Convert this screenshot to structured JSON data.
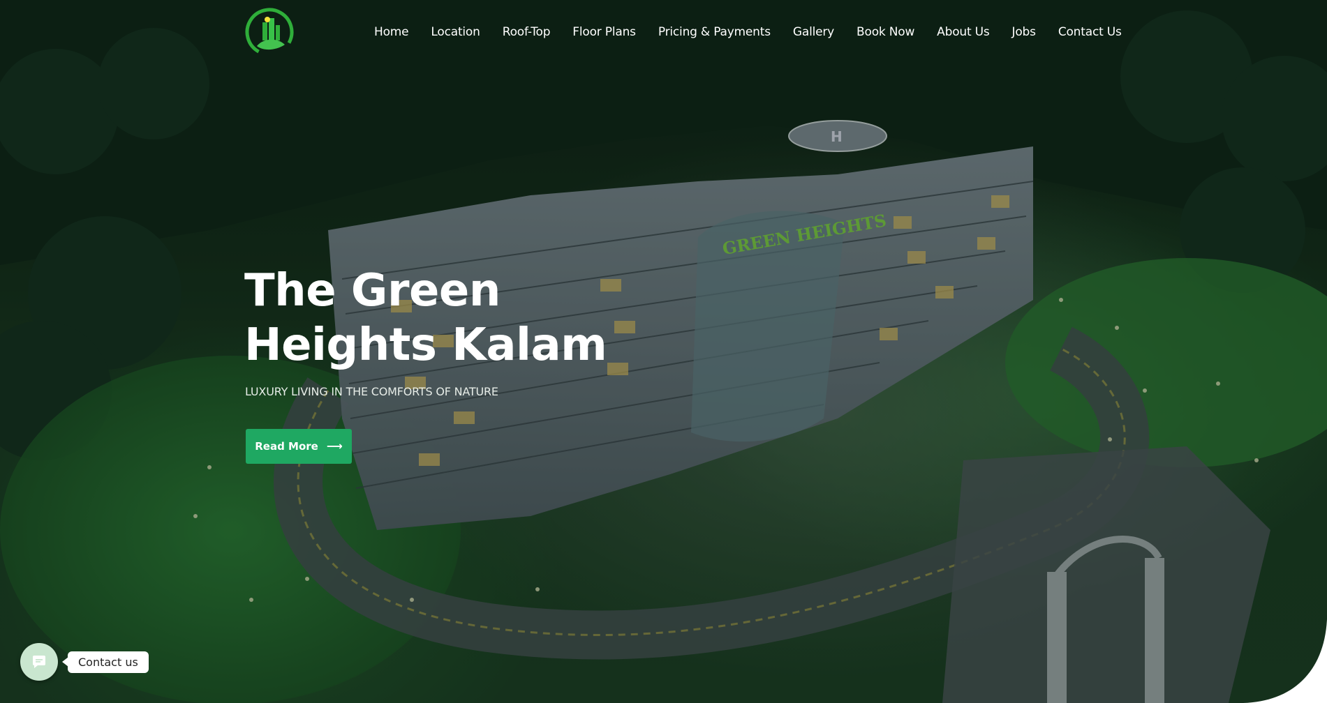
{
  "brand": {
    "logo_icon": "green-heights-logo-icon",
    "accent_color": "#1fa862"
  },
  "nav": {
    "items": [
      {
        "label": "Home"
      },
      {
        "label": "Location"
      },
      {
        "label": "Roof-Top"
      },
      {
        "label": "Floor Plans"
      },
      {
        "label": "Pricing & Payments"
      },
      {
        "label": "Gallery"
      },
      {
        "label": "Book Now"
      },
      {
        "label": "About Us"
      },
      {
        "label": "Jobs"
      },
      {
        "label": "Contact Us"
      }
    ]
  },
  "hero": {
    "title_line1": "The Green",
    "title_line2": "Heights Kalam",
    "subtitle": "LUXURY LIVING IN THE COMFORTS OF NATURE",
    "cta_label": "Read More",
    "cta_icon": "arrow-right-icon",
    "background_image": "green-heights-building-aerial-night",
    "building_sign_text": "GREEN HEIGHTS"
  },
  "contact_widget": {
    "label": "Contact us",
    "icon": "chat-icon",
    "circle_color": "#c9e6cf"
  }
}
